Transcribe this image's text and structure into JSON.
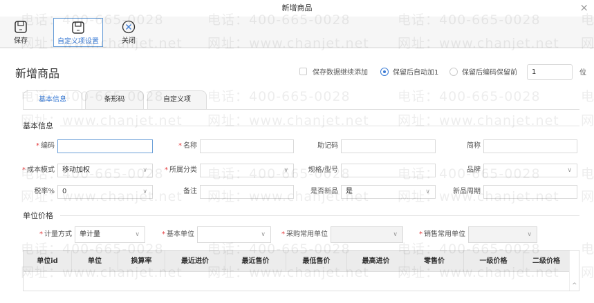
{
  "window": {
    "title": "新增商品",
    "close": "×"
  },
  "toolbar": {
    "save": "保存",
    "custom": "自定义项设置",
    "close": "关闭"
  },
  "heading": "新增商品",
  "options": {
    "continue_add": "保存数据继续添加",
    "auto_inc": "保留后自动加1",
    "keep_prefix": "保留后编码保留前",
    "digits_value": "1",
    "digits_unit": "位"
  },
  "tabs": [
    "基本信息",
    "条形码",
    "自定义项"
  ],
  "sections": {
    "basic": "基本信息",
    "price": "单位价格"
  },
  "fields": [
    {
      "label": "编码",
      "req": true,
      "value": "",
      "type": "input"
    },
    {
      "label": "名称",
      "req": true,
      "value": "",
      "type": "input"
    },
    {
      "label": "助记码",
      "req": false,
      "value": "",
      "type": "input"
    },
    {
      "label": "简称",
      "req": false,
      "value": "",
      "type": "input"
    },
    {
      "label": "成本模式",
      "req": true,
      "value": "移动加权",
      "type": "select"
    },
    {
      "label": "所属分类",
      "req": true,
      "value": "",
      "type": "select"
    },
    {
      "label": "规格/型号",
      "req": false,
      "value": "",
      "type": "input"
    },
    {
      "label": "品牌",
      "req": false,
      "value": "",
      "type": "select"
    },
    {
      "label": "税率%",
      "req": false,
      "value": "0",
      "type": "select"
    },
    {
      "label": "备注",
      "req": false,
      "value": "",
      "type": "input"
    },
    {
      "label": "是否新品",
      "req": false,
      "value": "是",
      "type": "select"
    },
    {
      "label": "新品周期",
      "req": false,
      "value": "",
      "type": "input"
    }
  ],
  "unit_fields": [
    {
      "label": "计量方式",
      "value": "单计量"
    },
    {
      "label": "基本单位",
      "value": ""
    },
    {
      "label": "采购常用单位",
      "value": ""
    },
    {
      "label": "销售常用单位",
      "value": ""
    }
  ],
  "table": {
    "columns": [
      "单位id",
      "单位",
      "换算率",
      "最近进价",
      "最近售价",
      "最低售价",
      "最高进价",
      "零售价",
      "一级价格",
      "二级价格"
    ]
  },
  "watermark": {
    "phone": "电话：400-665-0028",
    "site": "网址：www.chanjet.net"
  },
  "colors": {
    "accent": "#3a7bd5",
    "required": "#e4393c"
  }
}
